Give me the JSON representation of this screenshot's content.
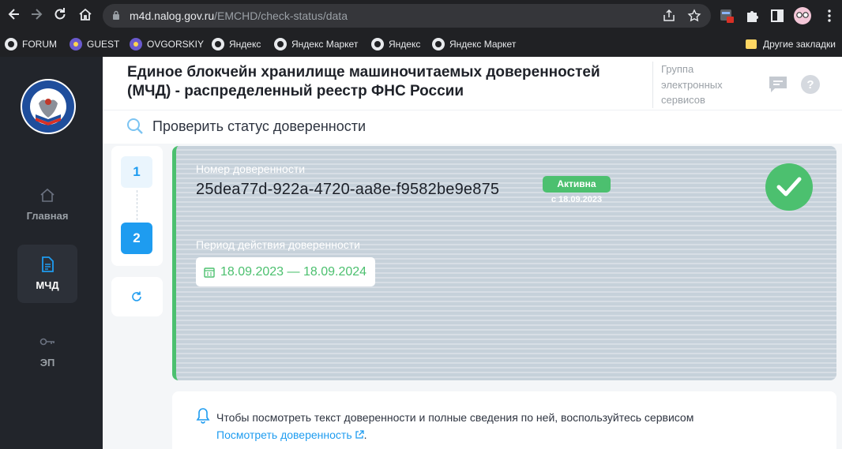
{
  "browser": {
    "url_host": "m4d.nalog.gov.ru",
    "url_path": "/EMCHD/check-status/data",
    "bookmarks": [
      {
        "label": "FORUM"
      },
      {
        "label": "GUEST"
      },
      {
        "label": "OVGORSKIY"
      },
      {
        "label": "Яндекс"
      },
      {
        "label": "Яндекс Маркет"
      },
      {
        "label": "Яндекс"
      },
      {
        "label": "Яндекс Маркет"
      }
    ],
    "other_bookmarks": "Другие закладки"
  },
  "sidebar": {
    "items": [
      {
        "label": "Главная",
        "icon": "home-icon"
      },
      {
        "label": "МЧД",
        "icon": "document-icon"
      },
      {
        "label": "ЭП",
        "icon": "key-icon"
      }
    ]
  },
  "header": {
    "title": "Единое блокчейн хранилище машиночитаемых доверенностей (МЧД) - распределенный реестр ФНС России",
    "group": "Группа электронных сервисов"
  },
  "subheader": {
    "title": "Проверить статус доверенности"
  },
  "steps": [
    "1",
    "2"
  ],
  "card": {
    "number_label": "Номер доверенности",
    "number": "25dea77d-922a-4720-aa8e-f9582be9e875",
    "status": "Активна",
    "status_date": "с 18.09.2023",
    "period_label": "Период действия доверенности",
    "period": "18.09.2023 — 18.09.2024"
  },
  "notice": {
    "text": "Чтобы посмотреть текст доверенности и полные сведения по ней, воспользуйтесь сервисом ",
    "link": "Посмотреть доверенность",
    "tail": "."
  },
  "colors": {
    "accent": "#1e9cf0",
    "success": "#4cc06f",
    "sidebar": "#22252b"
  }
}
